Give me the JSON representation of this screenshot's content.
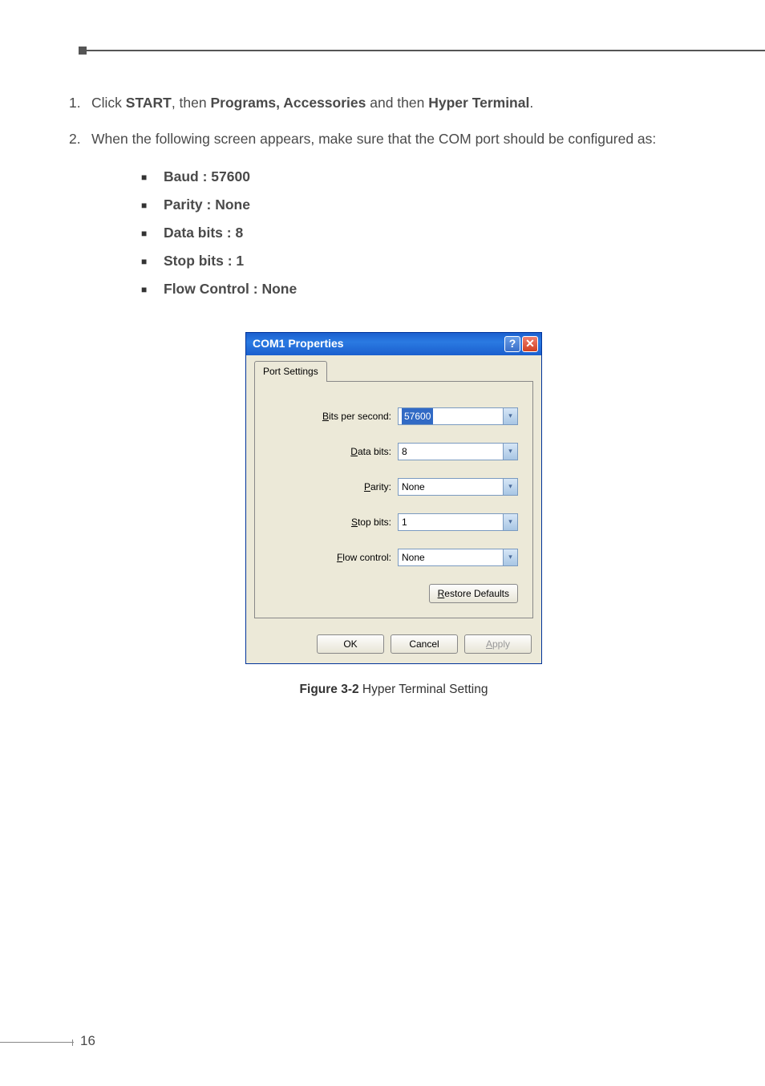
{
  "steps": {
    "s1": {
      "prefix": "Click ",
      "b1": "START",
      "mid1": ", then ",
      "b2": "Programs, Accessories",
      "mid2": " and then ",
      "b3": "Hyper Terminal",
      "suffix": "."
    },
    "s2": {
      "text": "When the following screen appears, make sure that the COM port should be configured as:"
    }
  },
  "bullets": {
    "b1": "Baud : 57600",
    "b2": "Parity : None",
    "b3": "Data bits : 8",
    "b4": "Stop bits : 1",
    "b5": "Flow Control : None"
  },
  "dialog": {
    "title": "COM1 Properties",
    "tab": "Port Settings",
    "fields": {
      "bits_label_u": "B",
      "bits_label_r": "its per second:",
      "bits_value": "57600",
      "data_label_u": "D",
      "data_label_r": "ata bits:",
      "data_value": "8",
      "parity_label_u": "P",
      "parity_label_r": "arity:",
      "parity_value": "None",
      "stop_label_u": "S",
      "stop_label_r": "top bits:",
      "stop_value": "1",
      "flow_label_u": "F",
      "flow_label_r": "low control:",
      "flow_value": "None"
    },
    "buttons": {
      "restore_u": "R",
      "restore_r": "estore Defaults",
      "ok": "OK",
      "cancel": "Cancel",
      "apply_u": "A",
      "apply_r": "pply"
    }
  },
  "caption": {
    "bold": "Figure 3-2",
    "rest": "  Hyper Terminal Setting"
  },
  "page_number": "16"
}
